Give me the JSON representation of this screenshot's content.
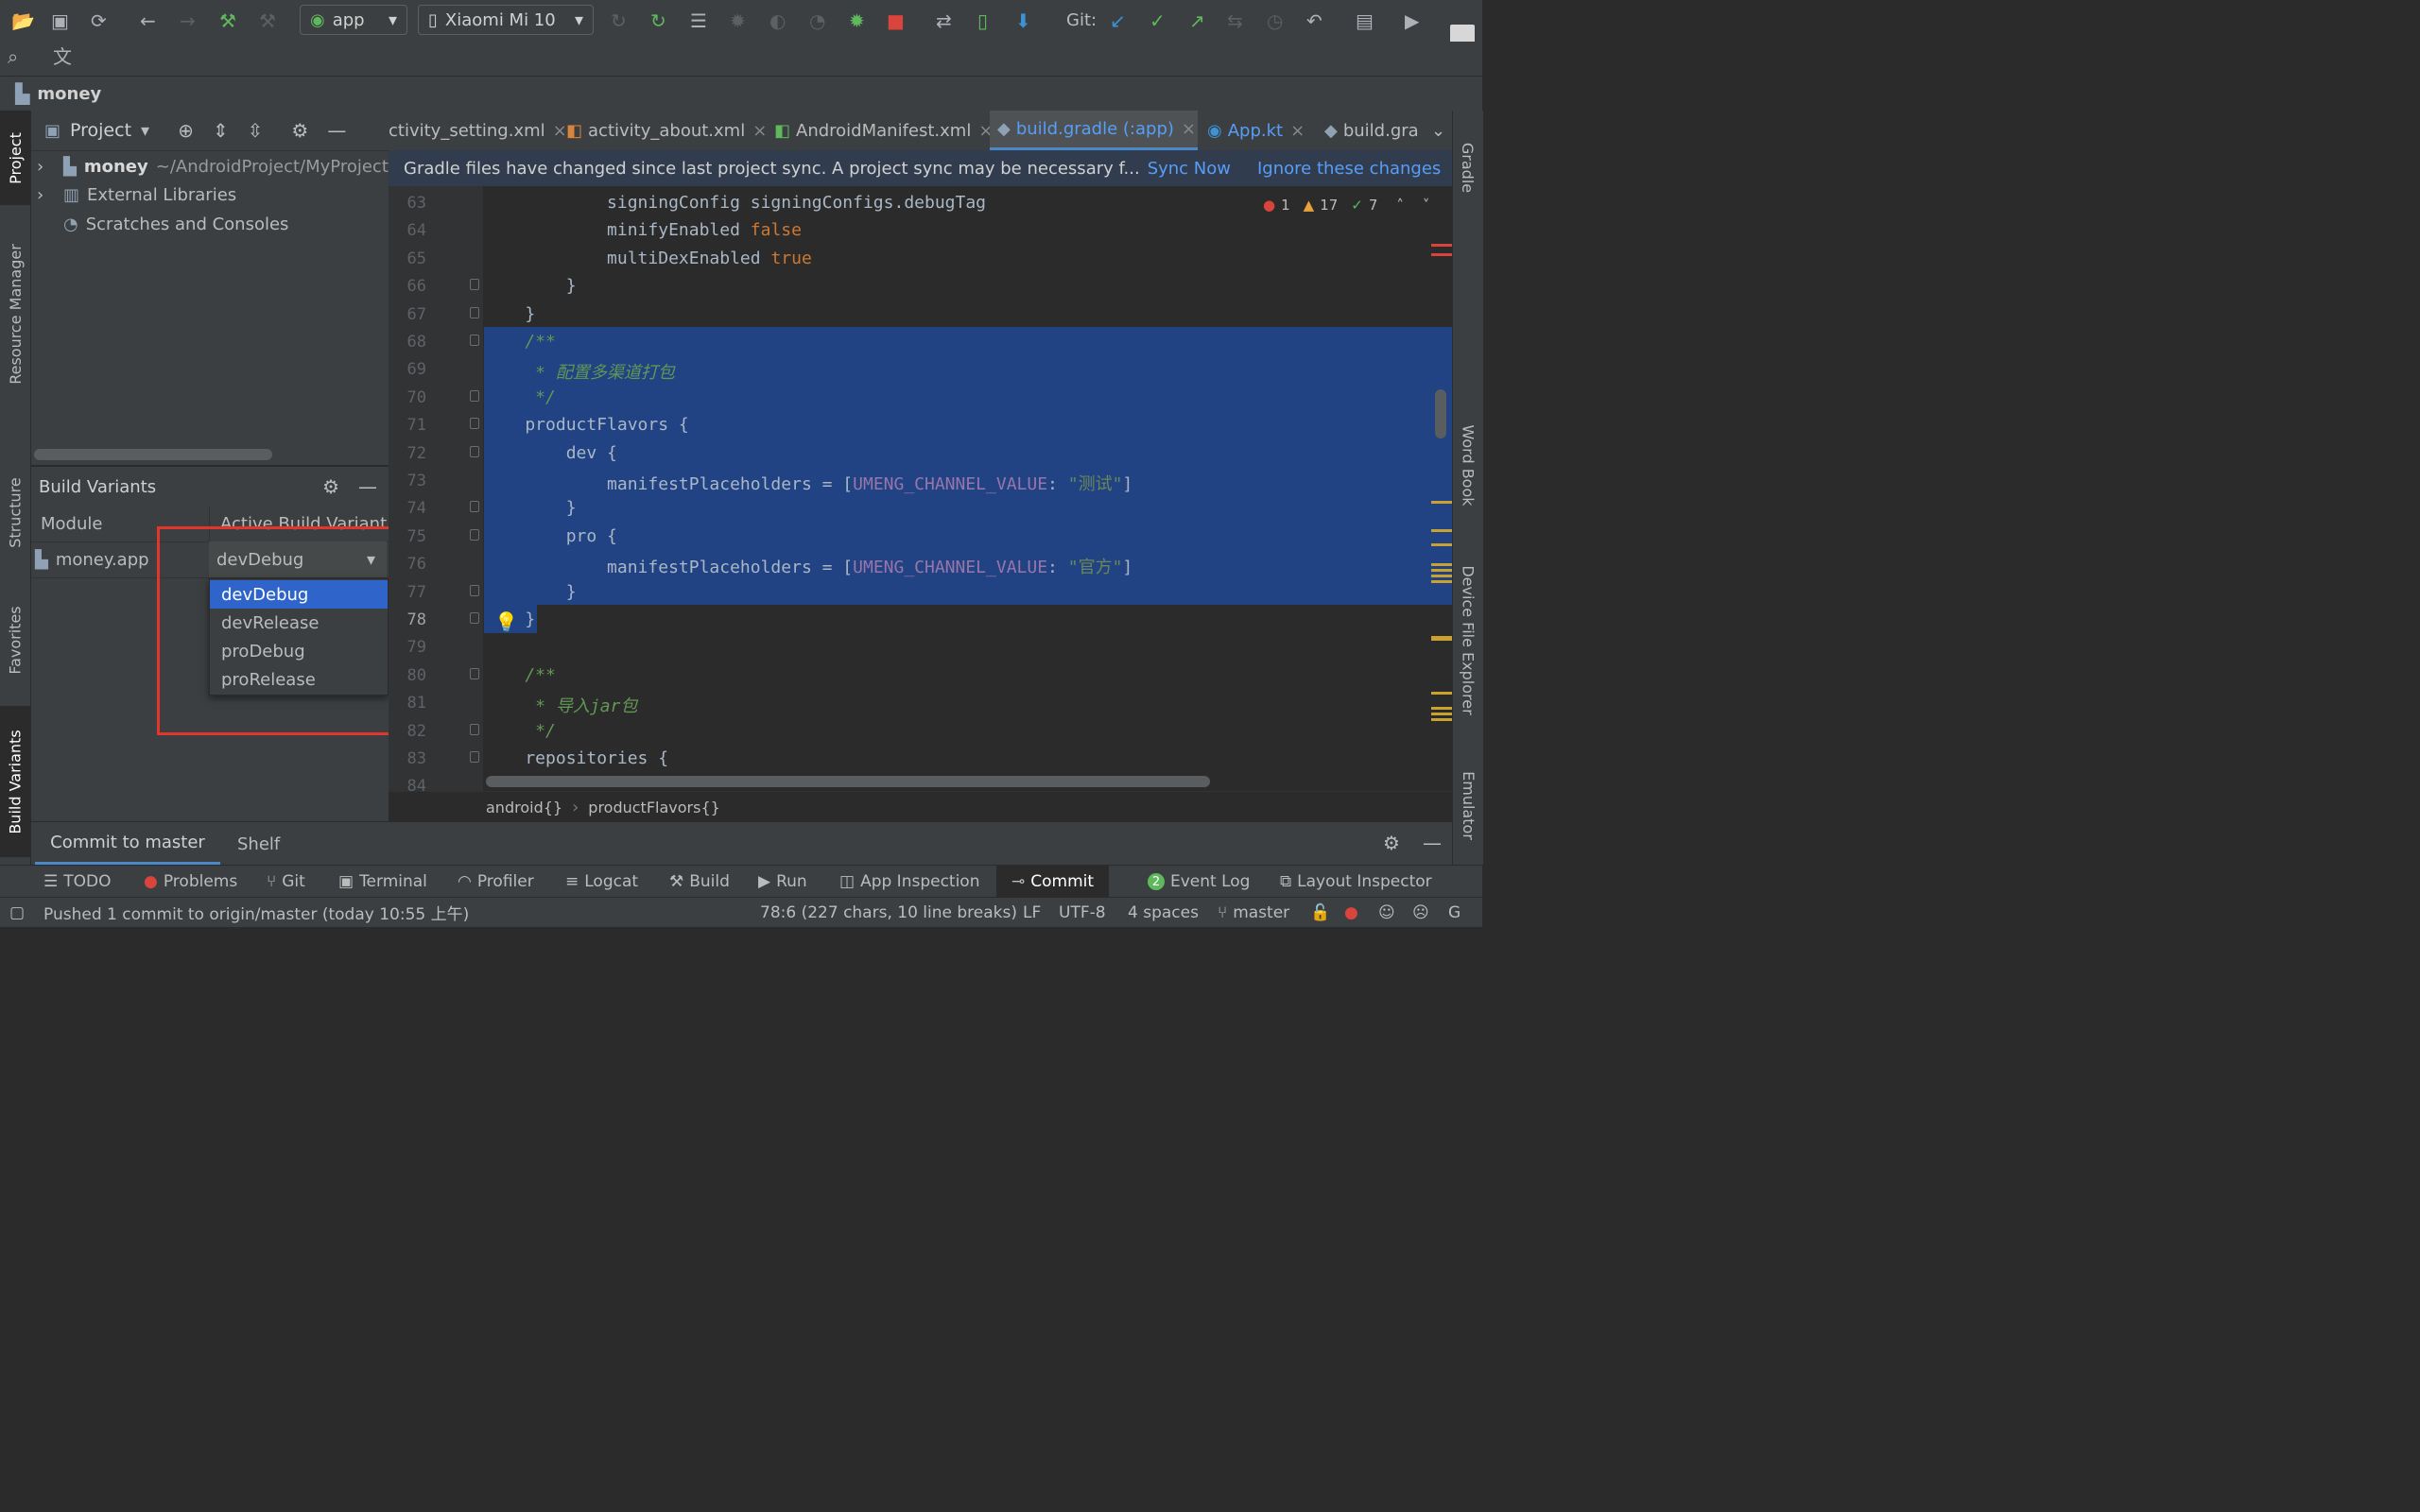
{
  "toolbar": {
    "run_config": "app",
    "device": "Xiaomi Mi 10",
    "git_label": "Git:"
  },
  "navbar": {
    "project_name": "money"
  },
  "left_tabs": [
    "Project",
    "Resource Manager",
    "Structure",
    "Favorites",
    "Build Variants"
  ],
  "right_tabs": [
    "Gradle",
    "Word Book",
    "Device File Explorer",
    "Emulator"
  ],
  "project_panel": {
    "title": "Project",
    "tree": [
      {
        "name": "money",
        "path": "~/AndroidProject/MyProject"
      },
      {
        "name": "External Libraries"
      },
      {
        "name": "Scratches and Consoles"
      }
    ]
  },
  "build_variants": {
    "title": "Build Variants",
    "col_module": "Module",
    "col_variant": "Active Build Variant",
    "module": "money.app",
    "selected": "devDebug",
    "options": [
      "devDebug",
      "devRelease",
      "proDebug",
      "proRelease"
    ]
  },
  "editor_tabs": [
    {
      "label": "ctivity_setting.xml",
      "active": false
    },
    {
      "label": "activity_about.xml",
      "active": false
    },
    {
      "label": "AndroidManifest.xml",
      "active": false
    },
    {
      "label": "build.gradle (:app)",
      "active": true
    },
    {
      "label": "App.kt",
      "active": false
    },
    {
      "label": "build.gra",
      "active": false
    }
  ],
  "notice": {
    "message": "Gradle files have changed since last project sync. A project sync may be necessary f...",
    "sync_now": "Sync Now",
    "ignore": "Ignore these changes"
  },
  "inspections": {
    "errors": "1",
    "warnings": "17",
    "weak": "7"
  },
  "code_lines": [
    {
      "n": "63",
      "parts": [
        [
          "            signingConfig signingConfigs.debugTag",
          ""
        ]
      ]
    },
    {
      "n": "64",
      "parts": [
        [
          "            minifyEnabled ",
          ""
        ],
        [
          "false",
          "kw"
        ]
      ]
    },
    {
      "n": "65",
      "parts": [
        [
          "            multiDexEnabled ",
          ""
        ],
        [
          "true",
          "kw"
        ]
      ]
    },
    {
      "n": "66",
      "parts": [
        [
          "        }",
          ""
        ]
      ]
    },
    {
      "n": "67",
      "parts": [
        [
          "    }",
          ""
        ]
      ]
    },
    {
      "n": "68",
      "parts": [
        [
          "    /**",
          "cm"
        ]
      ]
    },
    {
      "n": "69",
      "parts": [
        [
          "     * 配置多渠道打包",
          "cm"
        ]
      ]
    },
    {
      "n": "70",
      "parts": [
        [
          "     */",
          "cm"
        ]
      ]
    },
    {
      "n": "71",
      "parts": [
        [
          "    productFlavors {",
          ""
        ]
      ]
    },
    {
      "n": "72",
      "parts": [
        [
          "        dev {",
          ""
        ]
      ]
    },
    {
      "n": "73",
      "parts": [
        [
          "            manifestPlaceholders = [",
          ""
        ],
        [
          "UMENG_CHANNEL_VALUE",
          "hl"
        ],
        [
          ": ",
          ""
        ],
        [
          "\"测试\"",
          "str"
        ],
        [
          "]",
          ""
        ]
      ]
    },
    {
      "n": "74",
      "parts": [
        [
          "        }",
          ""
        ]
      ]
    },
    {
      "n": "75",
      "parts": [
        [
          "        pro {",
          ""
        ]
      ]
    },
    {
      "n": "76",
      "parts": [
        [
          "            manifestPlaceholders = [",
          ""
        ],
        [
          "UMENG_CHANNEL_VALUE",
          "hl"
        ],
        [
          ": ",
          ""
        ],
        [
          "\"官方\"",
          "str"
        ],
        [
          "]",
          ""
        ]
      ]
    },
    {
      "n": "77",
      "parts": [
        [
          "        }",
          ""
        ]
      ]
    },
    {
      "n": "78",
      "parts": [
        [
          "    }",
          ""
        ]
      ]
    },
    {
      "n": "79",
      "parts": [
        [
          "",
          ""
        ]
      ]
    },
    {
      "n": "80",
      "parts": [
        [
          "    /**",
          "cm"
        ]
      ]
    },
    {
      "n": "81",
      "parts": [
        [
          "     * 导入jar包",
          "cm"
        ]
      ]
    },
    {
      "n": "82",
      "parts": [
        [
          "     */",
          "cm"
        ]
      ]
    },
    {
      "n": "83",
      "parts": [
        [
          "    repositories {",
          ""
        ]
      ]
    },
    {
      "n": "84",
      "parts": [
        [
          "",
          ""
        ]
      ]
    }
  ],
  "breadcrumbs": [
    "android{}",
    "productFlavors{}"
  ],
  "commit_bar": {
    "tab1": "Commit to master",
    "tab2": "Shelf"
  },
  "bottom_tabs": {
    "todo": "TODO",
    "problems": "Problems",
    "git": "Git",
    "terminal": "Terminal",
    "profiler": "Profiler",
    "logcat": "Logcat",
    "build": "Build",
    "run": "Run",
    "app_inspection": "App Inspection",
    "commit": "Commit",
    "event_log": "Event Log",
    "event_log_count": "2",
    "layout_inspector": "Layout Inspector"
  },
  "status": {
    "message": "Pushed 1 commit to origin/master (today 10:55 上午)",
    "position": "78:6 (227 chars, 10 line breaks)",
    "line_sep": "LF",
    "encoding": "UTF-8",
    "indent": "4 spaces",
    "branch": "master"
  },
  "colors": {
    "selection": "#214283",
    "accent": "#2f65ca",
    "highlight_box": "#e0362c"
  }
}
